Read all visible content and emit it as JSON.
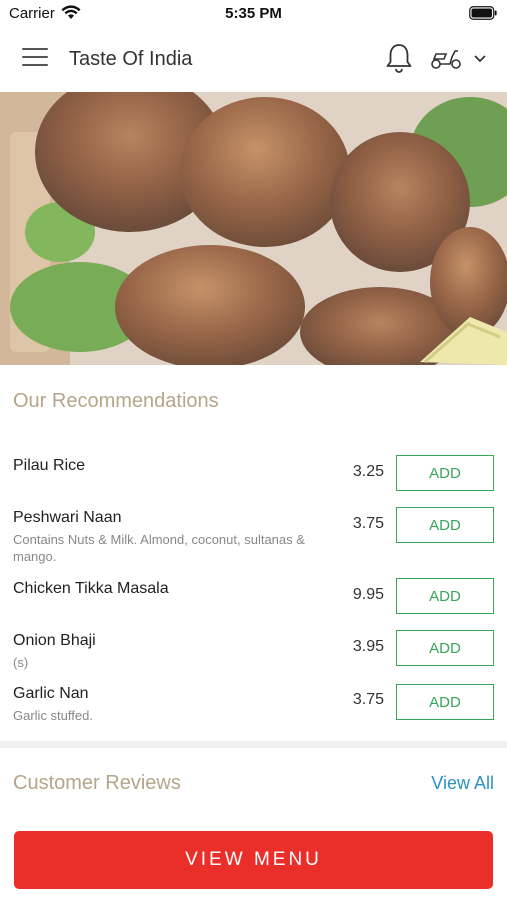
{
  "status_bar": {
    "carrier": "Carrier",
    "time": "5:35 PM"
  },
  "header": {
    "title": "Taste Of India"
  },
  "recommendations": {
    "title": "Our Recommendations",
    "items": [
      {
        "name": "Pilau Rice",
        "desc": "",
        "price": "3.25",
        "add": "ADD"
      },
      {
        "name": "Peshwari Naan",
        "desc": "Contains Nuts & Milk. Almond, coconut, sultanas & mango.",
        "price": "3.75",
        "add": "ADD"
      },
      {
        "name": "Chicken Tikka Masala",
        "desc": "",
        "price": "9.95",
        "add": "ADD"
      },
      {
        "name": "Onion Bhaji",
        "desc": "(s)",
        "price": "3.95",
        "add": "ADD"
      },
      {
        "name": "Garlic Nan",
        "desc": "Garlic stuffed.",
        "price": "3.75",
        "add": "ADD"
      }
    ]
  },
  "reviews": {
    "title": "Customer Reviews",
    "view_all": "View All"
  },
  "footer": {
    "view_menu": "VIEW MENU"
  },
  "colors": {
    "accent_green": "#3aa45a",
    "cta_red": "#ea2f2a",
    "link_blue": "#2b93c4",
    "section_title": "#b5a58a"
  },
  "icons": [
    "wifi-icon",
    "battery-icon",
    "menu-icon",
    "bell-icon",
    "scooter-icon",
    "chevron-down-icon"
  ]
}
